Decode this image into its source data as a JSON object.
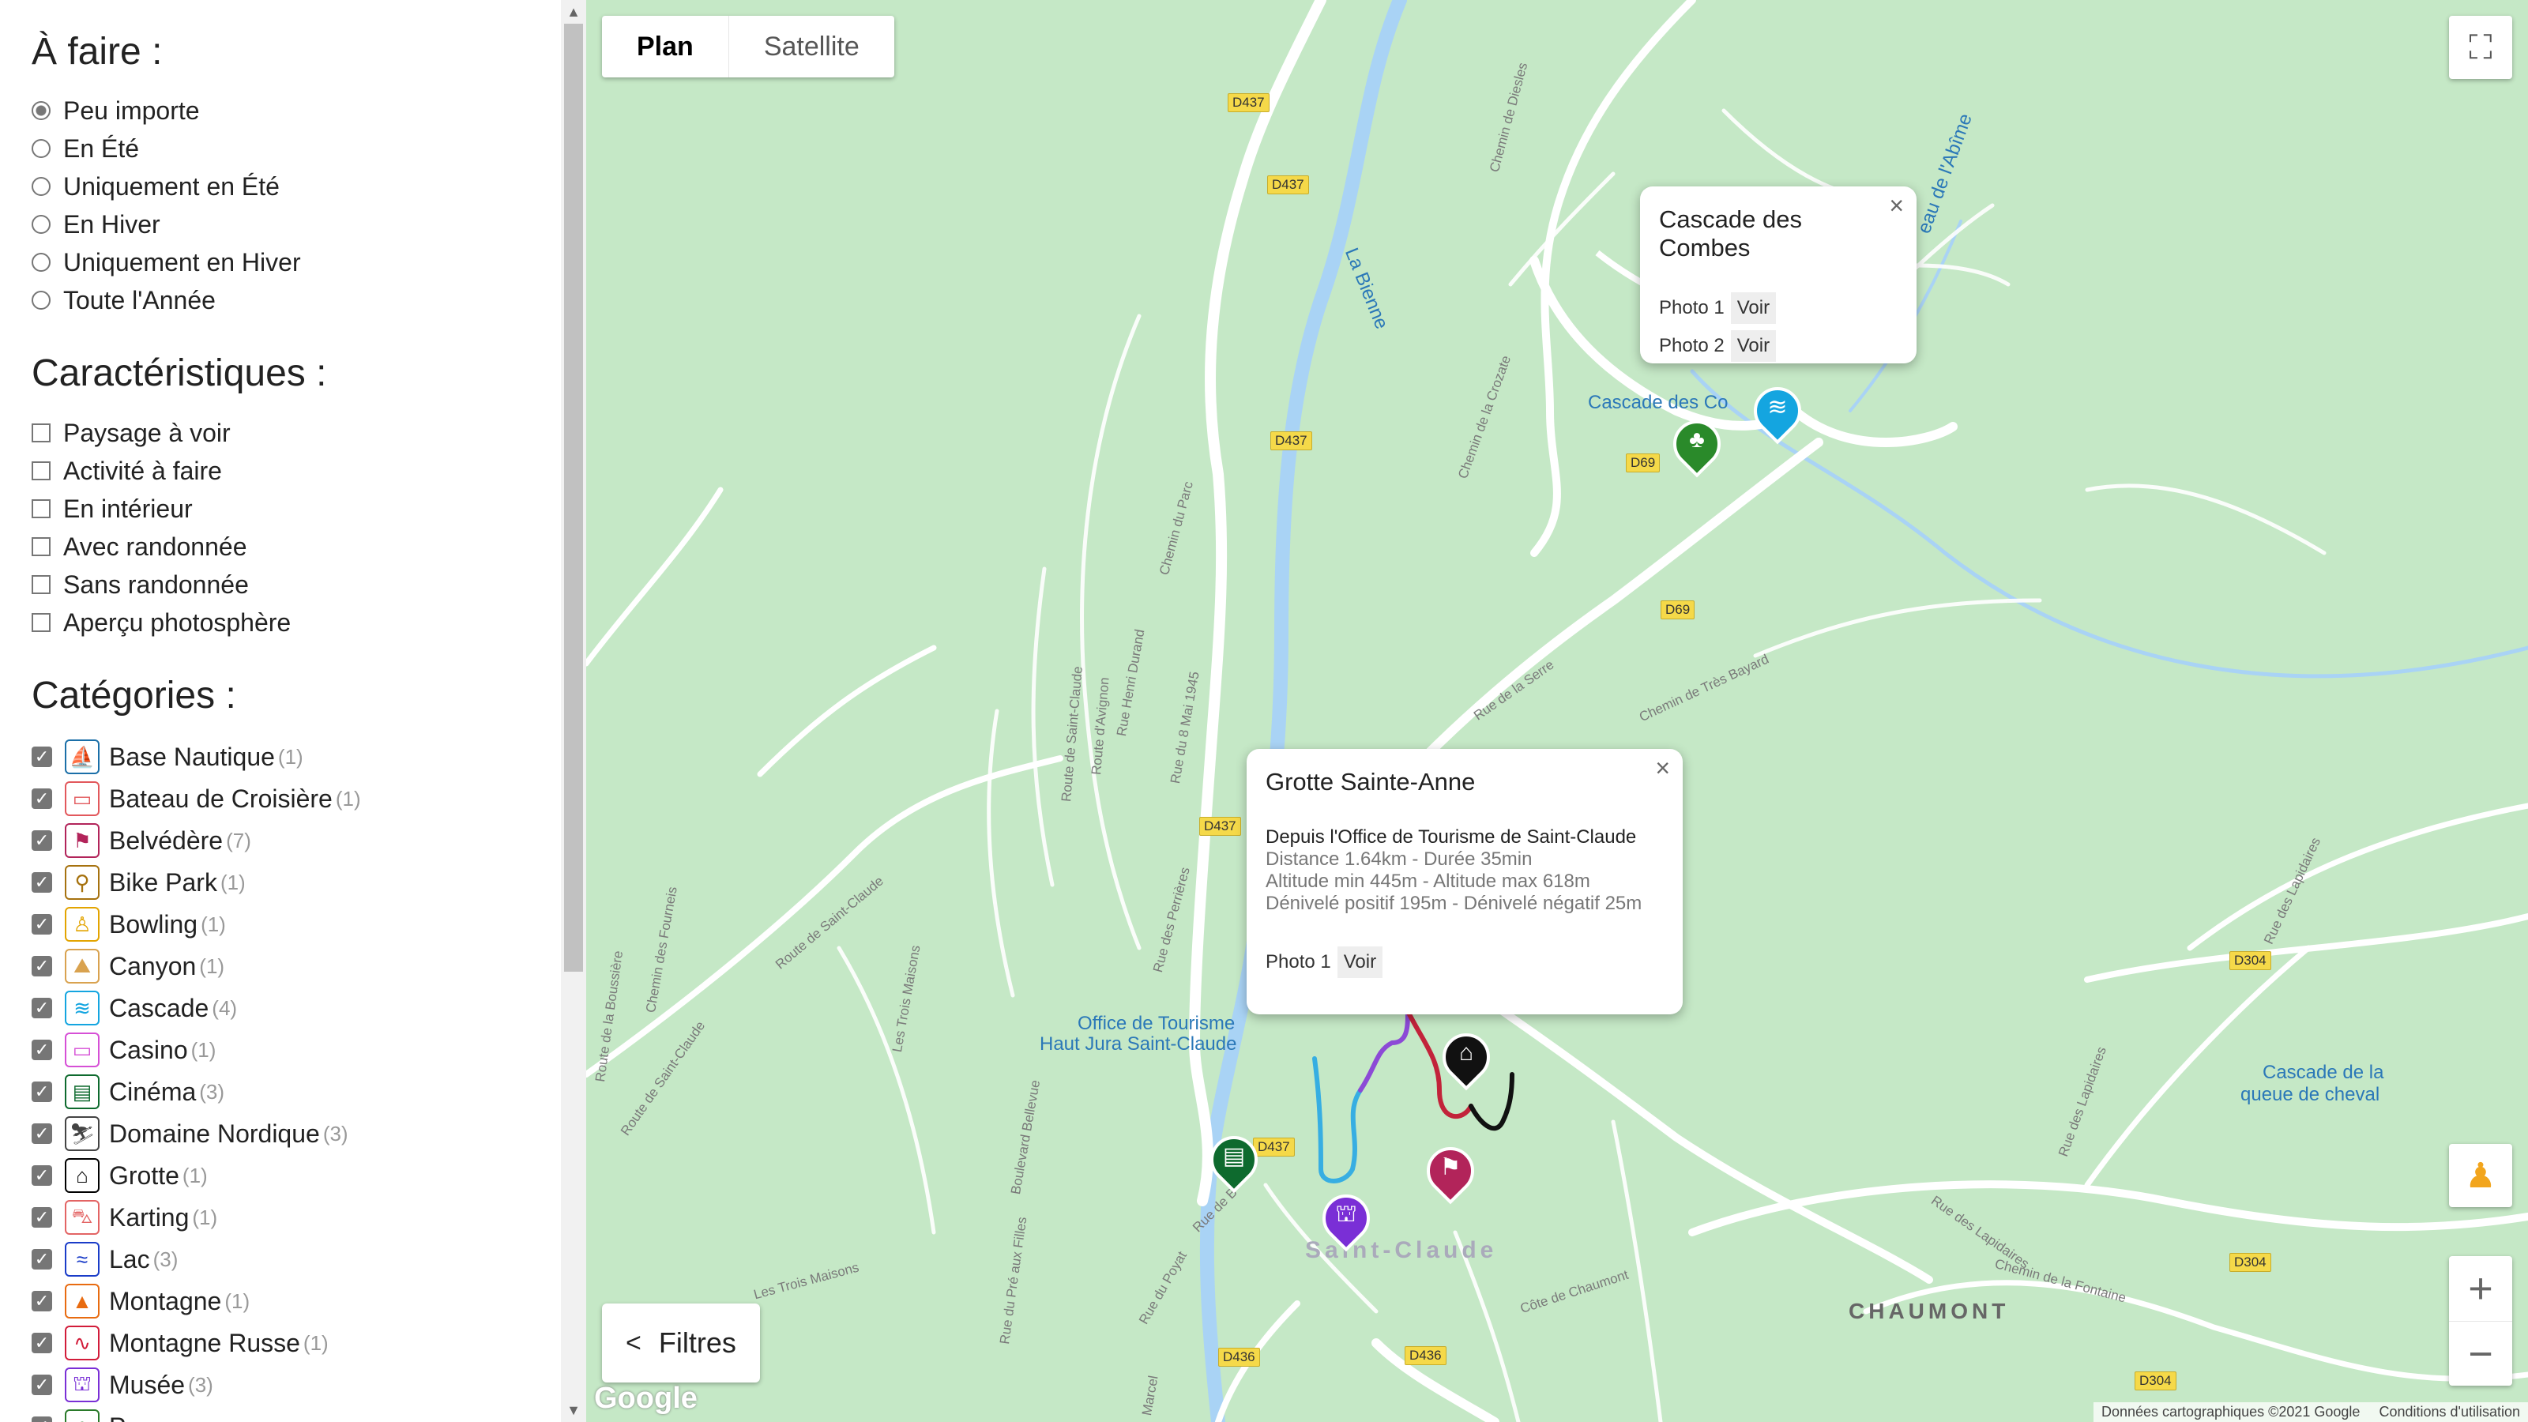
{
  "sidebar": {
    "todo_title": "À faire :",
    "todo_options": [
      {
        "label": "Peu importe",
        "selected": true
      },
      {
        "label": "En Été",
        "selected": false
      },
      {
        "label": "Uniquement en Été",
        "selected": false
      },
      {
        "label": "En Hiver",
        "selected": false
      },
      {
        "label": "Uniquement en Hiver",
        "selected": false
      },
      {
        "label": "Toute l'Année",
        "selected": false
      }
    ],
    "features_title": "Caractéristiques :",
    "features": [
      {
        "label": "Paysage à voir",
        "checked": false
      },
      {
        "label": "Activité à faire",
        "checked": false
      },
      {
        "label": "En intérieur",
        "checked": false
      },
      {
        "label": "Avec randonnée",
        "checked": false
      },
      {
        "label": "Sans randonnée",
        "checked": false
      },
      {
        "label": "Aperçu photosphère",
        "checked": false
      }
    ],
    "categories_title": "Catégories :",
    "categories": [
      {
        "label": "Base Nautique",
        "count": "(1)",
        "icon": "sailboat-icon",
        "color": "#1b6fa8",
        "checked": true
      },
      {
        "label": "Bateau de Croisière",
        "count": "(1)",
        "icon": "cruise-ship-icon",
        "color": "#e2585c",
        "checked": true
      },
      {
        "label": "Belvédère",
        "count": "(7)",
        "icon": "viewpoint-icon",
        "color": "#b2245a",
        "checked": true
      },
      {
        "label": "Bike Park",
        "count": "(1)",
        "icon": "bike-icon",
        "color": "#a6720f",
        "checked": true
      },
      {
        "label": "Bowling",
        "count": "(1)",
        "icon": "bowling-icon",
        "color": "#e3a400",
        "checked": true
      },
      {
        "label": "Canyon",
        "count": "(1)",
        "icon": "canyon-icon",
        "color": "#d9a24f",
        "checked": true
      },
      {
        "label": "Cascade",
        "count": "(4)",
        "icon": "waterfall-icon",
        "color": "#14a5e0",
        "checked": true
      },
      {
        "label": "Casino",
        "count": "(1)",
        "icon": "casino-icon",
        "color": "#d64fd6",
        "checked": true
      },
      {
        "label": "Cinéma",
        "count": "(3)",
        "icon": "cinema-icon",
        "color": "#0e6a2e",
        "checked": true
      },
      {
        "label": "Domaine Nordique",
        "count": "(3)",
        "icon": "skier-icon",
        "color": "#444444",
        "checked": true
      },
      {
        "label": "Grotte",
        "count": "(1)",
        "icon": "cave-icon",
        "color": "#000000",
        "checked": true
      },
      {
        "label": "Karting",
        "count": "(1)",
        "icon": "kart-icon",
        "color": "#e36464",
        "checked": true
      },
      {
        "label": "Lac",
        "count": "(3)",
        "icon": "lake-icon",
        "color": "#1a3cc8",
        "checked": true
      },
      {
        "label": "Montagne",
        "count": "(1)",
        "icon": "mountain-icon",
        "color": "#e86b10",
        "checked": true
      },
      {
        "label": "Montagne Russe",
        "count": "(1)",
        "icon": "rollercoaster-icon",
        "color": "#d21c3a",
        "checked": true
      },
      {
        "label": "Musée",
        "count": "(3)",
        "icon": "museum-icon",
        "color": "#7a2fd6",
        "checked": true
      },
      {
        "label": "P",
        "count": "",
        "icon": "park-icon",
        "color": "#2a7a2a",
        "checked": true
      }
    ]
  },
  "map": {
    "type_buttons": [
      "Plan",
      "Satellite"
    ],
    "active_type": "Plan",
    "filters_label": "Filtres",
    "google": "Google",
    "attribution": "Données cartographiques ©2021 Google",
    "terms": "Conditions d'utilisation",
    "places": {
      "cascade_combes": "Cascade des Co",
      "office_1": "Office de Tourisme",
      "office_2": "Haut Jura Saint-Claude",
      "cascade_queue_1": "Cascade de la",
      "cascade_queue_2": "queue de cheval",
      "river": "La Bienne",
      "ruisseau": "eau de l'Abîme",
      "saint_claude": "Saint-Claude",
      "chaumont": "CHAUMONT"
    },
    "shields": [
      "D437",
      "D437",
      "D437",
      "D437",
      "D437",
      "D69",
      "D69",
      "D304",
      "D304",
      "D304",
      "D436",
      "D436"
    ],
    "roads": {
      "chemin_diesles": "Chemin de Diesles",
      "chemin_crozate": "Chemin de la Crozate",
      "chemin_parc": "Chemin du Parc",
      "route_saint_claude": "Route de Saint-Claude",
      "route_avignon": "Route d'Avignon",
      "rue_durand": "Rue Henri Durand",
      "rue_8mai": "Rue du 8 Mai 1945",
      "rue_serre": "Rue de la Serre",
      "chemin_tres_bayard": "Chemin de Très Bayard",
      "rue_lapidaires": "Rue des Lapidaires",
      "rue_lapidaires_2": "Rue des Lapidaires",
      "rue_lapidaires_3": "Rue des Lapidaires",
      "chemin_fontaine": "Chemin de la Fontaine",
      "cote_chaumont": "Côte de Chaumont",
      "route_saint_claude_2": "Route de Saint-Claude",
      "route_saint_claude_3": "Route de Saint-Claude",
      "route_boussiere": "Route de la Boussière",
      "chemin_fourneis": "Chemin des Fourneis",
      "les_trois_maisons": "Les Trois Maisons",
      "les_trois_maisons_2": "Les Trois Maisons",
      "rue_perrieres": "Rue des Perrières",
      "boulevard_belle": "Boulevard Bellevue",
      "rue_pre_filles": "Rue du Pré aux Filles",
      "rue_poyat": "Rue du Poyat",
      "rue_marcel": "Marcel",
      "rue_b": "Rue de B"
    }
  },
  "popups": {
    "combes": {
      "title": "Cascade des Combes",
      "photos": [
        {
          "label": "Photo 1",
          "action": "Voir"
        },
        {
          "label": "Photo 2",
          "action": "Voir"
        }
      ]
    },
    "grotte": {
      "title": "Grotte Sainte-Anne",
      "subtitle": "Depuis l'Office de Tourisme de Saint-Claude",
      "lines": [
        "Distance 1.64km - Durée 35min",
        "Altitude min 445m - Altitude max 618m",
        "Dénivelé positif 195m - Dénivelé négatif 25m"
      ],
      "photos": [
        {
          "label": "Photo 1",
          "action": "Voir"
        }
      ]
    }
  },
  "colors": {
    "map_bg": "#c5e8c6",
    "road": "#ffffff",
    "river": "#a9d3f5",
    "water_label": "#2b78b8",
    "shield": "#f5d949"
  }
}
